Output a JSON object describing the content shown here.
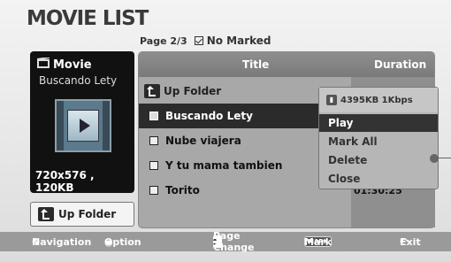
{
  "screen_title": "MOVIE LIST",
  "page": {
    "page_label": "Page 2/3",
    "marked_label": "No Marked"
  },
  "preview": {
    "type_label": "Movie",
    "file_name": "Buscando Lety",
    "info": "720x576 , 120KB"
  },
  "up_folder_button": "Up Folder",
  "list": {
    "col_title": "Title",
    "col_duration": "Duration",
    "up_folder_row": "Up Folder",
    "items": [
      {
        "title": "Buscando Lety",
        "selected": true
      },
      {
        "title": "Nube viajera",
        "selected": false
      },
      {
        "title": "Y tu mama tambien",
        "selected": false
      },
      {
        "title": "Torito",
        "selected": false,
        "duration": "01:30:25"
      }
    ]
  },
  "popup": {
    "file_info": "4395KB 1Kbps",
    "items": [
      "Play",
      "Mark All",
      "Delete",
      "Close"
    ],
    "active_index": 0
  },
  "footer": {
    "navigation": "Navigation",
    "option": "Option",
    "page_change": "Page Change",
    "mark": "Mark",
    "mark_badge": "MARK",
    "exit": "Exit"
  }
}
